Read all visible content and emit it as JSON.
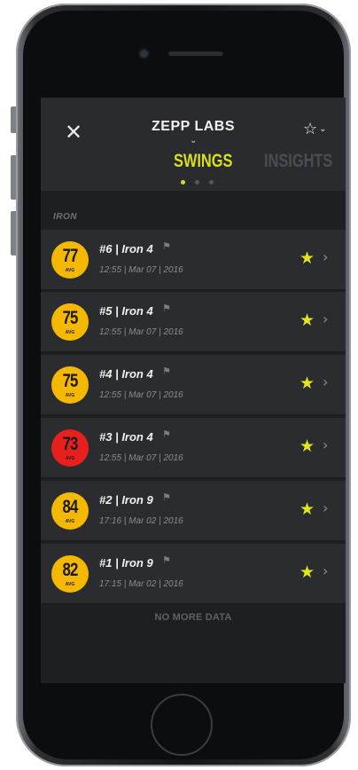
{
  "header": {
    "close_icon": "close-icon",
    "brand": "ZEPP LABS",
    "brand_caret": "chevron-down-icon",
    "favorite_icon": "star-outline-icon",
    "tabs": [
      {
        "label": "SWINGS",
        "active": true
      },
      {
        "label": "INSIGHTS",
        "active": false
      }
    ],
    "page_dots": {
      "count": 3,
      "active_index": 0
    }
  },
  "section": {
    "label": "IRON"
  },
  "swings": [
    {
      "score": "77",
      "avg_label": "AVG",
      "title": "#6 | Iron 4",
      "date": "12:55 | Mar 07 | 2016",
      "badge_color": "#f5b800",
      "starred": true
    },
    {
      "score": "75",
      "avg_label": "AVG",
      "title": "#5 | Iron 4",
      "date": "12:55 | Mar 07 | 2016",
      "badge_color": "#f5b800",
      "starred": true
    },
    {
      "score": "75",
      "avg_label": "AVG",
      "title": "#4 | Iron 4",
      "date": "12:55 | Mar 07 | 2016",
      "badge_color": "#f5b800",
      "starred": true
    },
    {
      "score": "73",
      "avg_label": "AVG",
      "title": "#3 | Iron 4",
      "date": "12:55 | Mar 07 | 2016",
      "badge_color": "#e8201d",
      "starred": true
    },
    {
      "score": "84",
      "avg_label": "AVG",
      "title": "#2 | Iron 9",
      "date": "17:16 | Mar 02 | 2016",
      "badge_color": "#f5b800",
      "starred": true
    },
    {
      "score": "82",
      "avg_label": "AVG",
      "title": "#1 | Iron 9",
      "date": "17:15 | Mar 02 | 2016",
      "badge_color": "#f5b800",
      "starred": true
    }
  ],
  "footer": {
    "label": "NO MORE DATA"
  },
  "colors": {
    "accent": "#d6df1e",
    "star": "#e2e61d",
    "badge_yellow": "#f5b800",
    "badge_red": "#e8201d"
  }
}
